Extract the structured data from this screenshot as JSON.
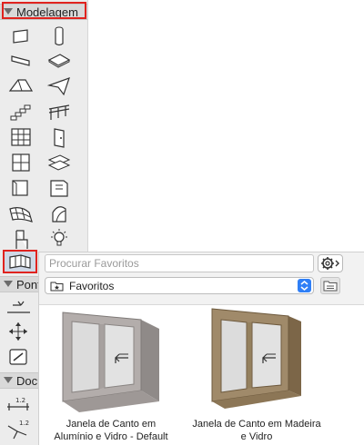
{
  "toolbox": {
    "sections": [
      {
        "label": "Modelagem"
      },
      {
        "label": "Pont"
      },
      {
        "label": "Docu"
      }
    ],
    "design_tools": [
      "wall-tool",
      "column-tool",
      "beam-tool",
      "slab-tool",
      "roof-tool",
      "shell-tool",
      "stair-tool",
      "railing-tool",
      "curtain-wall-tool",
      "door-tool",
      "window-tool",
      "skylight-tool",
      "wall-end-tool",
      "corner-window-tool",
      "mesh-tool",
      "zone-tool",
      "object-tool",
      "lamp-tool"
    ],
    "active_tool": "corner-window-tool",
    "doc_tools": [
      "dimension-tool",
      "level-dimension-tool",
      "text-tool",
      "label-tool"
    ]
  },
  "favorites": {
    "search_placeholder": "Procurar Favoritos",
    "folder_selected": "Favoritos",
    "items": [
      {
        "caption_line1": "Janela de Canto em",
        "caption_line2": "Alumínio e Vidro - Default",
        "color": "#b3adab"
      },
      {
        "caption_line1": "Janela de Canto em Madeira",
        "caption_line2": "e Vidro",
        "color": "#a08a6a"
      }
    ]
  },
  "colors": {
    "highlight": "#e0231f",
    "accent": "#2f7ff6"
  }
}
